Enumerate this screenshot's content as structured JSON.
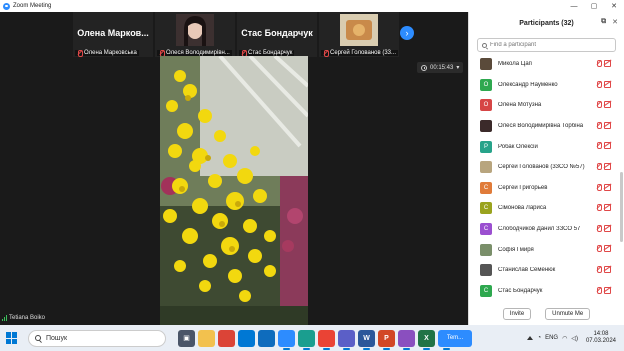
{
  "window": {
    "title": "Zoom Meeting",
    "controls": [
      "—",
      "▢",
      "✕"
    ]
  },
  "video": {
    "tiles": [
      {
        "display": "Олена Марков...",
        "caption": "Олена Марковська",
        "type": "name"
      },
      {
        "display": "",
        "caption": "Олеся Володимирівн...",
        "type": "photo",
        "photo_color": "#2a2222"
      },
      {
        "display": "Стас Бондарчук",
        "caption": "Стас Бондарчук",
        "type": "name"
      },
      {
        "display": "",
        "caption": "Сергей Голованов (33...",
        "type": "photo",
        "photo_color": "#cfc2a4"
      }
    ],
    "next_icon": "chevron-right-icon",
    "timer": "00:15:43",
    "self_name": "Tetiana Boiko"
  },
  "participants": {
    "title": "Participants (32)",
    "search_placeholder": "Find a participant",
    "list": [
      {
        "initial": "",
        "name": "Микола Цап",
        "color": "#5a4a3a"
      },
      {
        "initial": "О",
        "name": "Олександр Науменко",
        "color": "#2ea84f"
      },
      {
        "initial": "О",
        "name": "Олена Мотузна",
        "color": "#d64545"
      },
      {
        "initial": "",
        "name": "Олеся Володимирівна Торбіна",
        "color": "#3b2a2a"
      },
      {
        "initial": "Р",
        "name": "Робак Олексій",
        "color": "#27a38a"
      },
      {
        "initial": "",
        "name": "Сергей Голованов (33СО №57)",
        "color": "#b8a57e"
      },
      {
        "initial": "С",
        "name": "Сергей Григорьев",
        "color": "#e07b39"
      },
      {
        "initial": "С",
        "name": "Сімонова Лариса",
        "color": "#9aa31e"
      },
      {
        "initial": "С",
        "name": "Слободчиков Данил ЗЗСО 57",
        "color": "#9b4fd0"
      },
      {
        "initial": "",
        "name": "Софія Гмиря",
        "color": "#7a8f6a"
      },
      {
        "initial": "",
        "name": "Станислав Семенюк",
        "color": "#555555"
      },
      {
        "initial": "С",
        "name": "Стас Бондарчук",
        "color": "#2ea84f"
      },
      {
        "initial": "",
        "name": "",
        "color": "#6a5a50"
      }
    ],
    "invite_label": "Invite",
    "unmute_label": "Unmute Me"
  },
  "taskbar": {
    "search_text": "Пошук",
    "apps": [
      {
        "icon": "task-view-icon",
        "glyph": "▣",
        "color": "#4a5568"
      },
      {
        "icon": "file-explorer-icon",
        "glyph": "",
        "color": "#f2c14e"
      },
      {
        "icon": "chrome-icon",
        "glyph": "",
        "color": "#db4437"
      },
      {
        "icon": "store-icon",
        "glyph": "",
        "color": "#0078d4"
      },
      {
        "icon": "mail-icon",
        "glyph": "",
        "color": "#0f6cbd"
      },
      {
        "icon": "zoom-icon",
        "glyph": "",
        "color": "#2d8cff"
      },
      {
        "icon": "edge-icon",
        "glyph": "",
        "color": "#1a9e8f"
      },
      {
        "icon": "chrome-profile-icon",
        "glyph": "",
        "color": "#ea4335"
      },
      {
        "icon": "teams-icon",
        "glyph": "",
        "color": "#5b5fc7"
      },
      {
        "icon": "word-icon",
        "glyph": "W",
        "color": "#2b579a"
      },
      {
        "icon": "powerpoint-icon",
        "glyph": "P",
        "color": "#d24726"
      },
      {
        "icon": "paint-icon",
        "glyph": "",
        "color": "#8a4fbf"
      },
      {
        "icon": "excel-icon",
        "glyph": "X",
        "color": "#217346"
      },
      {
        "icon": "zoom-meeting-task-icon",
        "glyph": "Tem...",
        "color": "#2d8cff"
      }
    ],
    "lang": "ENG",
    "time": "14:08",
    "date": "07.03.2024"
  }
}
